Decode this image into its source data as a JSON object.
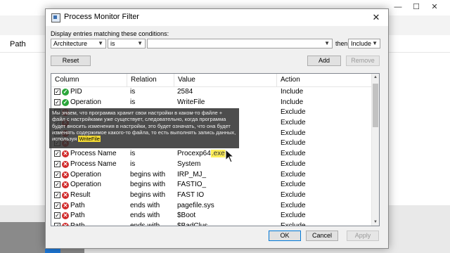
{
  "background": {
    "column_label": "Path"
  },
  "dialog": {
    "title": "Process Monitor Filter",
    "conditions_label": "Display entries matching these conditions:",
    "column_select": "Architecture",
    "relation_select": "is",
    "value_input": "",
    "then_label": "then",
    "action_select": "Include",
    "reset_label": "Reset",
    "add_label": "Add",
    "remove_label": "Remove",
    "ok_label": "OK",
    "cancel_label": "Cancel",
    "apply_label": "Apply"
  },
  "list": {
    "headers": [
      "Column",
      "Relation",
      "Value",
      "Action"
    ],
    "rows": [
      {
        "column": "PID",
        "relation": "is",
        "value": "2584",
        "action": "Include",
        "status": "ok"
      },
      {
        "column": "Operation",
        "relation": "is",
        "value": "WriteFile",
        "action": "Include",
        "status": "ok"
      },
      {
        "column": "",
        "relation": "",
        "value": "",
        "action": "Exclude",
        "status": "no"
      },
      {
        "column": "",
        "relation": "",
        "value": "",
        "action": "Exclude",
        "status": "no"
      },
      {
        "column": "",
        "relation": "",
        "value": "",
        "action": "Exclude",
        "status": "no"
      },
      {
        "column": "",
        "relation": "",
        "value": "",
        "action": "Exclude",
        "status": "no"
      },
      {
        "column": "Process Name",
        "relation": "is",
        "value": "Procexp64.exe",
        "action": "Exclude",
        "status": "no"
      },
      {
        "column": "Process Name",
        "relation": "is",
        "value": "System",
        "action": "Exclude",
        "status": "no"
      },
      {
        "column": "Operation",
        "relation": "begins with",
        "value": "IRP_MJ_",
        "action": "Exclude",
        "status": "no"
      },
      {
        "column": "Operation",
        "relation": "begins with",
        "value": "FASTIO_",
        "action": "Exclude",
        "status": "no"
      },
      {
        "column": "Result",
        "relation": "begins with",
        "value": "FAST IO",
        "action": "Exclude",
        "status": "no"
      },
      {
        "column": "Path",
        "relation": "ends with",
        "value": "pagefile.sys",
        "action": "Exclude",
        "status": "no"
      },
      {
        "column": "Path",
        "relation": "ends with",
        "value": "$Boot",
        "action": "Exclude",
        "status": "no"
      },
      {
        "column": "Path",
        "relation": "ends with",
        "value": "$BadClus",
        "action": "Exclude",
        "status": "no"
      }
    ]
  },
  "tooltip": {
    "text": "Мы знаем, что программа хранит свои настройки в каком-то файле + файл с настройками уже существует, следовательно, когда программа будет вносить изменения в настройки, это будет означать, что она будет изменять содержимое какого-то файла, то есть выполнять запись данных, используя",
    "highlight": "WriteFile"
  },
  "icons": {
    "ok": "check-circle-icon",
    "no": "x-circle-icon"
  }
}
